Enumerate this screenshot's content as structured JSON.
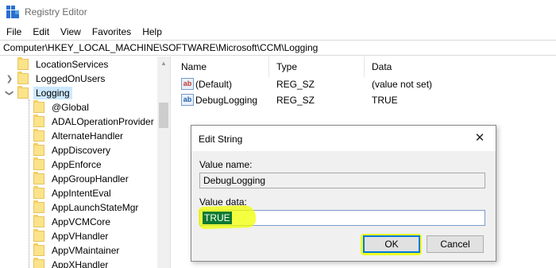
{
  "window": {
    "title": "Registry Editor"
  },
  "menu": [
    "File",
    "Edit",
    "View",
    "Favorites",
    "Help"
  ],
  "address": "Computer\\HKEY_LOCAL_MACHINE\\SOFTWARE\\Microsoft\\CCM\\Logging",
  "tree": {
    "items": [
      {
        "label": "LocationServices",
        "expandable": false
      },
      {
        "label": "LoggedOnUsers",
        "expandable": true,
        "expanded": false
      },
      {
        "label": "Logging",
        "expandable": true,
        "expanded": true,
        "selected": true
      },
      {
        "label": "@Global"
      },
      {
        "label": "ADALOperationProvider"
      },
      {
        "label": "AlternateHandler"
      },
      {
        "label": "AppDiscovery"
      },
      {
        "label": "AppEnforce"
      },
      {
        "label": "AppGroupHandler"
      },
      {
        "label": "AppIntentEval"
      },
      {
        "label": "AppLaunchStateMgr"
      },
      {
        "label": "AppVCMCore"
      },
      {
        "label": "AppVHandler"
      },
      {
        "label": "AppVMaintainer"
      },
      {
        "label": "AppXHandler"
      }
    ]
  },
  "values_list": {
    "columns": [
      "Name",
      "Type",
      "Data"
    ],
    "rows": [
      {
        "icon": "string-value-icon",
        "name": "(Default)",
        "type": "REG_SZ",
        "data": "(value not set)"
      },
      {
        "icon": "string-value-icon",
        "name": "DebugLogging",
        "type": "REG_SZ",
        "data": "TRUE"
      }
    ]
  },
  "dialog": {
    "title": "Edit String",
    "close_glyph": "✕",
    "value_name_label": "Value name:",
    "value_name": "DebugLogging",
    "value_data_label": "Value data:",
    "value_data": "TRUE",
    "ok_label": "OK",
    "cancel_label": "Cancel"
  },
  "colors": {
    "highlight": "#f0ff00",
    "selection_green": "#0a7a2f",
    "accent": "#0078d7"
  }
}
